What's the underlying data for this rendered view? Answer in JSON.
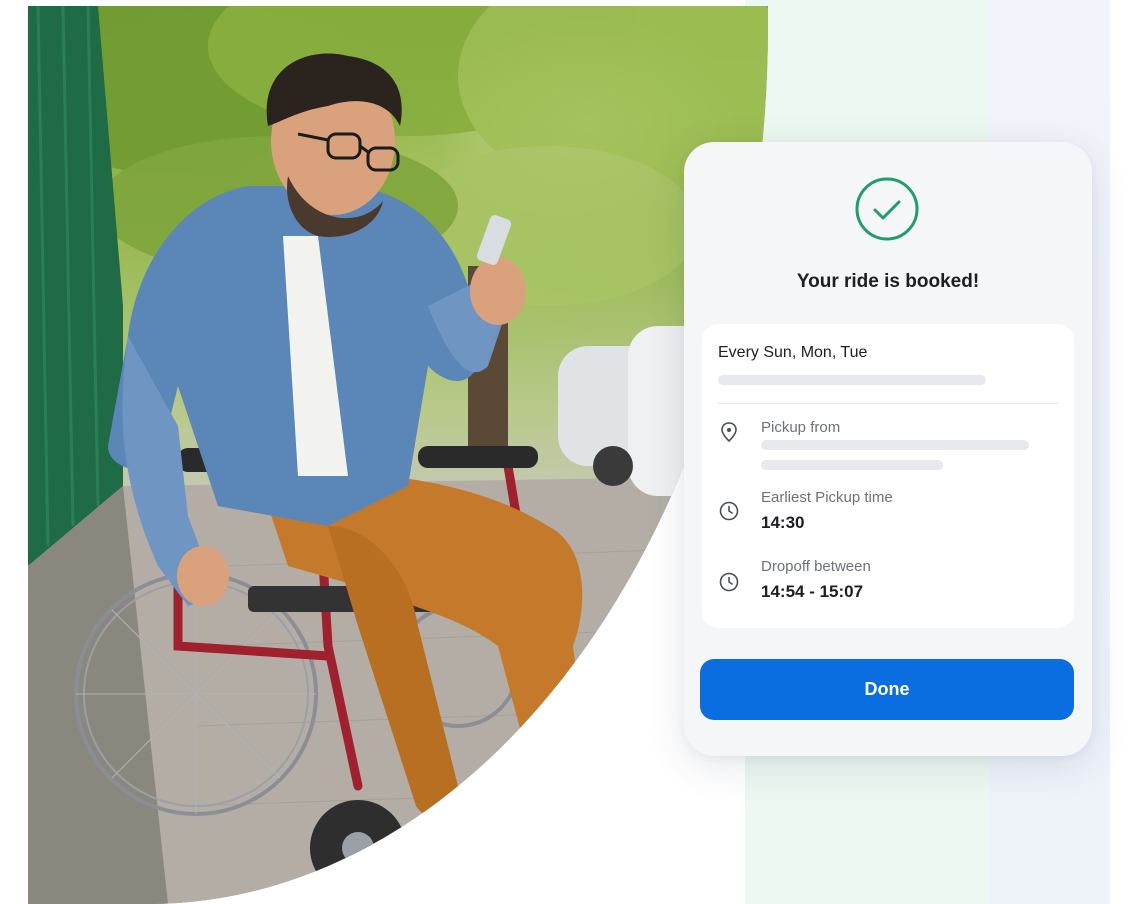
{
  "card": {
    "title": "Your ride is booked!",
    "schedule": "Every Sun, Mon, Tue",
    "pickup": {
      "label": "Pickup from",
      "icon": "location-pin-icon"
    },
    "earliest": {
      "label": "Earliest Pickup time",
      "value": "14:30",
      "icon": "clock-icon"
    },
    "dropoff": {
      "label": "Dropoff between",
      "value": "14:54 - 15:07",
      "icon": "clock-icon"
    },
    "done_label": "Done"
  },
  "colors": {
    "accent": "#0a6ee0",
    "success": "#1f9d6b"
  }
}
